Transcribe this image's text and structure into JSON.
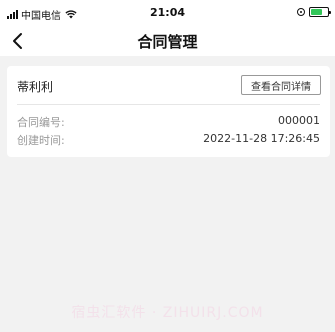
{
  "status_bar": {
    "carrier": "中国电信",
    "time": "21:04",
    "battery_color": "#32c759"
  },
  "nav": {
    "title": "合同管理",
    "back_icon": "chevron-left-icon"
  },
  "contract": {
    "name": "蒂利利",
    "detail_button": "查看合同详情",
    "fields": [
      {
        "label": "合同编号:",
        "value": "000001"
      },
      {
        "label": "创建时间:",
        "value": "2022-11-28 17:26:45"
      }
    ]
  },
  "watermark": "宿虫汇软件 · ZIHUIRJ.COM"
}
